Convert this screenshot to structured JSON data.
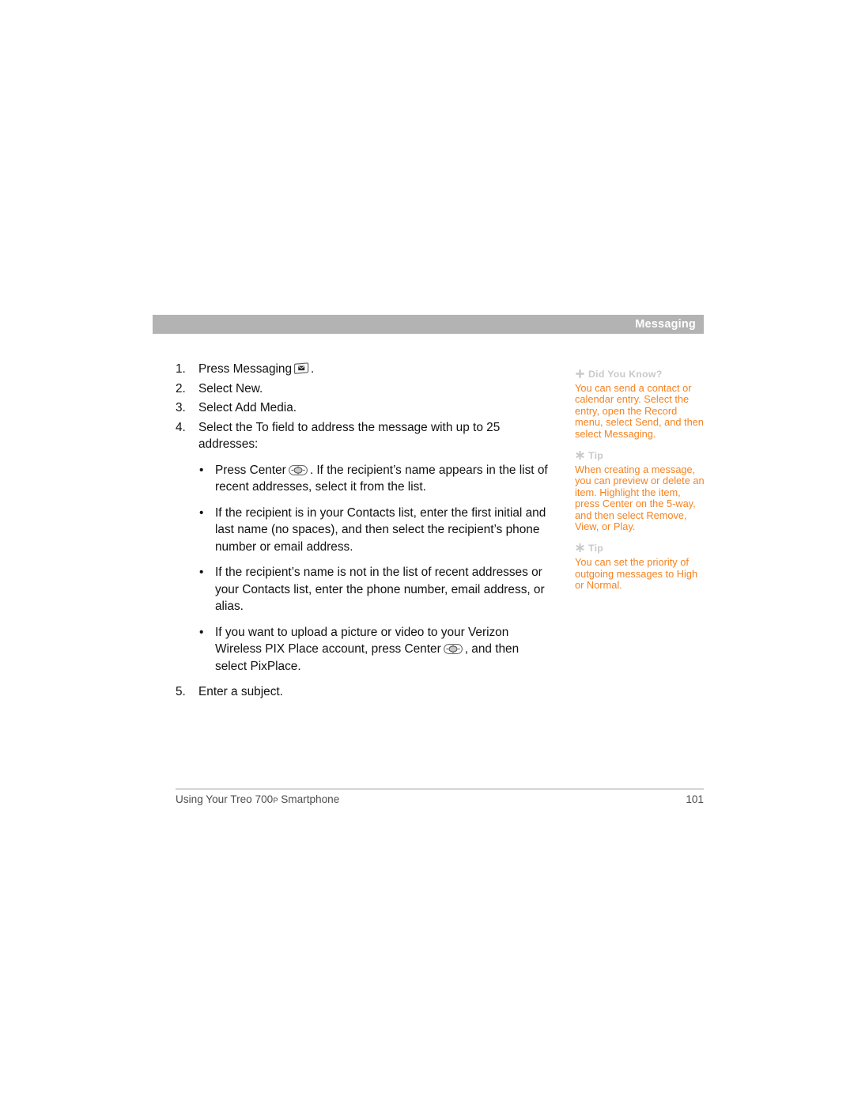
{
  "header": {
    "title": "Messaging",
    "bar_color": "#b3b3b3",
    "title_color": "#ffffff"
  },
  "main": {
    "steps": [
      {
        "number": "1.",
        "text_before": "Press Messaging",
        "icon": "messaging-key-icon",
        "text_after": "."
      },
      {
        "number": "2.",
        "text_before": "Select New.",
        "icon": "",
        "text_after": ""
      },
      {
        "number": "3.",
        "text_before": "Select Add Media.",
        "icon": "",
        "text_after": ""
      },
      {
        "number": "4.",
        "text_before": "Select the To field to address the message with up to 25 addresses:",
        "icon": "",
        "text_after": ""
      }
    ],
    "bullets": [
      {
        "marker": "•",
        "text_before": "Press Center",
        "icon": "five-way-center-icon",
        "text_after": ". If the recipient’s name appears in the list of recent addresses, select it from the list."
      },
      {
        "marker": "•",
        "text_before": "If the recipient is in your Contacts list, enter the first initial and last name (no spaces), and then select the recipient’s phone number or email address.",
        "icon": "",
        "text_after": ""
      },
      {
        "marker": "•",
        "text_before": "If the recipient’s name is not in the list of recent addresses or your Contacts list, enter the phone number, email address, or alias.",
        "icon": "",
        "text_after": ""
      },
      {
        "marker": "•",
        "text_before": "If you want to upload a picture or video to your Verizon Wireless PIX Place account, press Center",
        "icon": "five-way-center-icon",
        "text_after": ", and then select PixPlace."
      }
    ],
    "final_step": {
      "number": "5.",
      "text_before": "Enter a subject.",
      "icon": "",
      "text_after": ""
    }
  },
  "sidebar": {
    "heading_color": "#c9c9c9",
    "body_color": "#f5821f",
    "tips": [
      {
        "glyph": "plus-icon",
        "heading": "Did You Know?",
        "body": "You can send a contact or calendar entry. Select the entry, open the Record menu, select Send, and then select Messaging."
      },
      {
        "glyph": "asterisk-icon",
        "heading": "Tip",
        "body": "When creating a message, you can preview or delete an item. Highlight the item, press Center on the 5-way, and then select Remove, View, or Play."
      },
      {
        "glyph": "asterisk-icon",
        "heading": "Tip",
        "body": "You can set the priority of outgoing messages to High or Normal."
      }
    ]
  },
  "footer": {
    "book_title_part1": "Using Your Treo 700",
    "book_title_sup": "P",
    "book_title_part2": "Smartphone",
    "page_number": "101"
  }
}
